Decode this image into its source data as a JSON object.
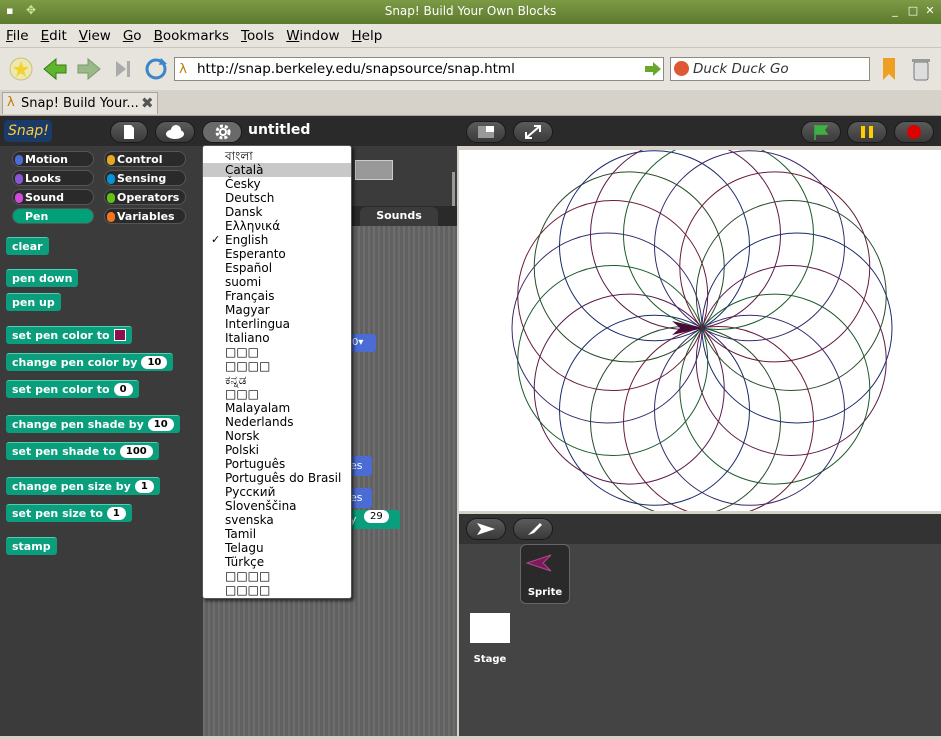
{
  "window": {
    "title": "Snap! Build Your Own Blocks",
    "min": "_",
    "max": "□",
    "close": "✕"
  },
  "menu": {
    "items": [
      {
        "label": "File",
        "key": "F"
      },
      {
        "label": "Edit",
        "key": "E"
      },
      {
        "label": "View",
        "key": "V"
      },
      {
        "label": "Go",
        "key": "G"
      },
      {
        "label": "Bookmarks",
        "key": "B"
      },
      {
        "label": "Tools",
        "key": "T"
      },
      {
        "label": "Window",
        "key": "W"
      },
      {
        "label": "Help",
        "key": "H"
      }
    ]
  },
  "toolbar": {
    "url": "http://snap.berkeley.edu/snapsource/snap.html",
    "search_placeholder": "Duck Duck Go"
  },
  "tab": {
    "title": "Snap! Build Your..."
  },
  "snap": {
    "logo": "Snap!",
    "project_title": "untitled",
    "categories": [
      {
        "label": "Motion",
        "color": "#4a6cd4"
      },
      {
        "label": "Control",
        "color": "#e6a822"
      },
      {
        "label": "Looks",
        "color": "#8a55d7"
      },
      {
        "label": "Sensing",
        "color": "#0494dc"
      },
      {
        "label": "Sound",
        "color": "#cf4ad9"
      },
      {
        "label": "Operators",
        "color": "#62c213"
      },
      {
        "label": "Pen",
        "color": "#00a178"
      },
      {
        "label": "Variables",
        "color": "#f3761d"
      }
    ],
    "blocks": {
      "clear": "clear",
      "pen_down": "pen down",
      "pen_up": "pen up",
      "set_pen_color": "set pen color to",
      "change_pen_color_by": "change pen color by",
      "change_pen_color_val": "10",
      "set_pen_color_to": "set pen color to",
      "set_pen_color_val": "0",
      "change_pen_shade_by": "change pen shade by",
      "change_pen_shade_val": "10",
      "set_pen_shade_to": "set pen shade to",
      "set_pen_shade_val": "100",
      "change_pen_size_by": "change pen size by",
      "change_pen_size_val": "1",
      "set_pen_size_to": "set pen size to",
      "set_pen_size_val": "1",
      "stamp": "stamp"
    },
    "sounds_tab": "Sounds",
    "partial_value": "29",
    "sprite_label": "Sprite",
    "stage_label": "Stage",
    "language_menu": [
      "বাংলা",
      "Català",
      "Česky",
      "Deutsch",
      "Dansk",
      "Ελληνικά",
      "English",
      "Esperanto",
      "Español",
      "suomi",
      "Français",
      "Magyar",
      "Interlingua",
      "Italiano",
      "□□□",
      "□□□□",
      "ಕನ್ನಡ",
      "□□□",
      "Malayalam",
      "Nederlands",
      "Norsk",
      "Polski",
      "Português",
      "Português do Brasil",
      "Русский",
      "Slovenščina",
      "svenska",
      "Tamil",
      "Telagu",
      "Türkçe",
      "□□□□",
      "□□□□"
    ],
    "language_selected": "English",
    "language_hover": "Català",
    "check_mark": "✓"
  }
}
